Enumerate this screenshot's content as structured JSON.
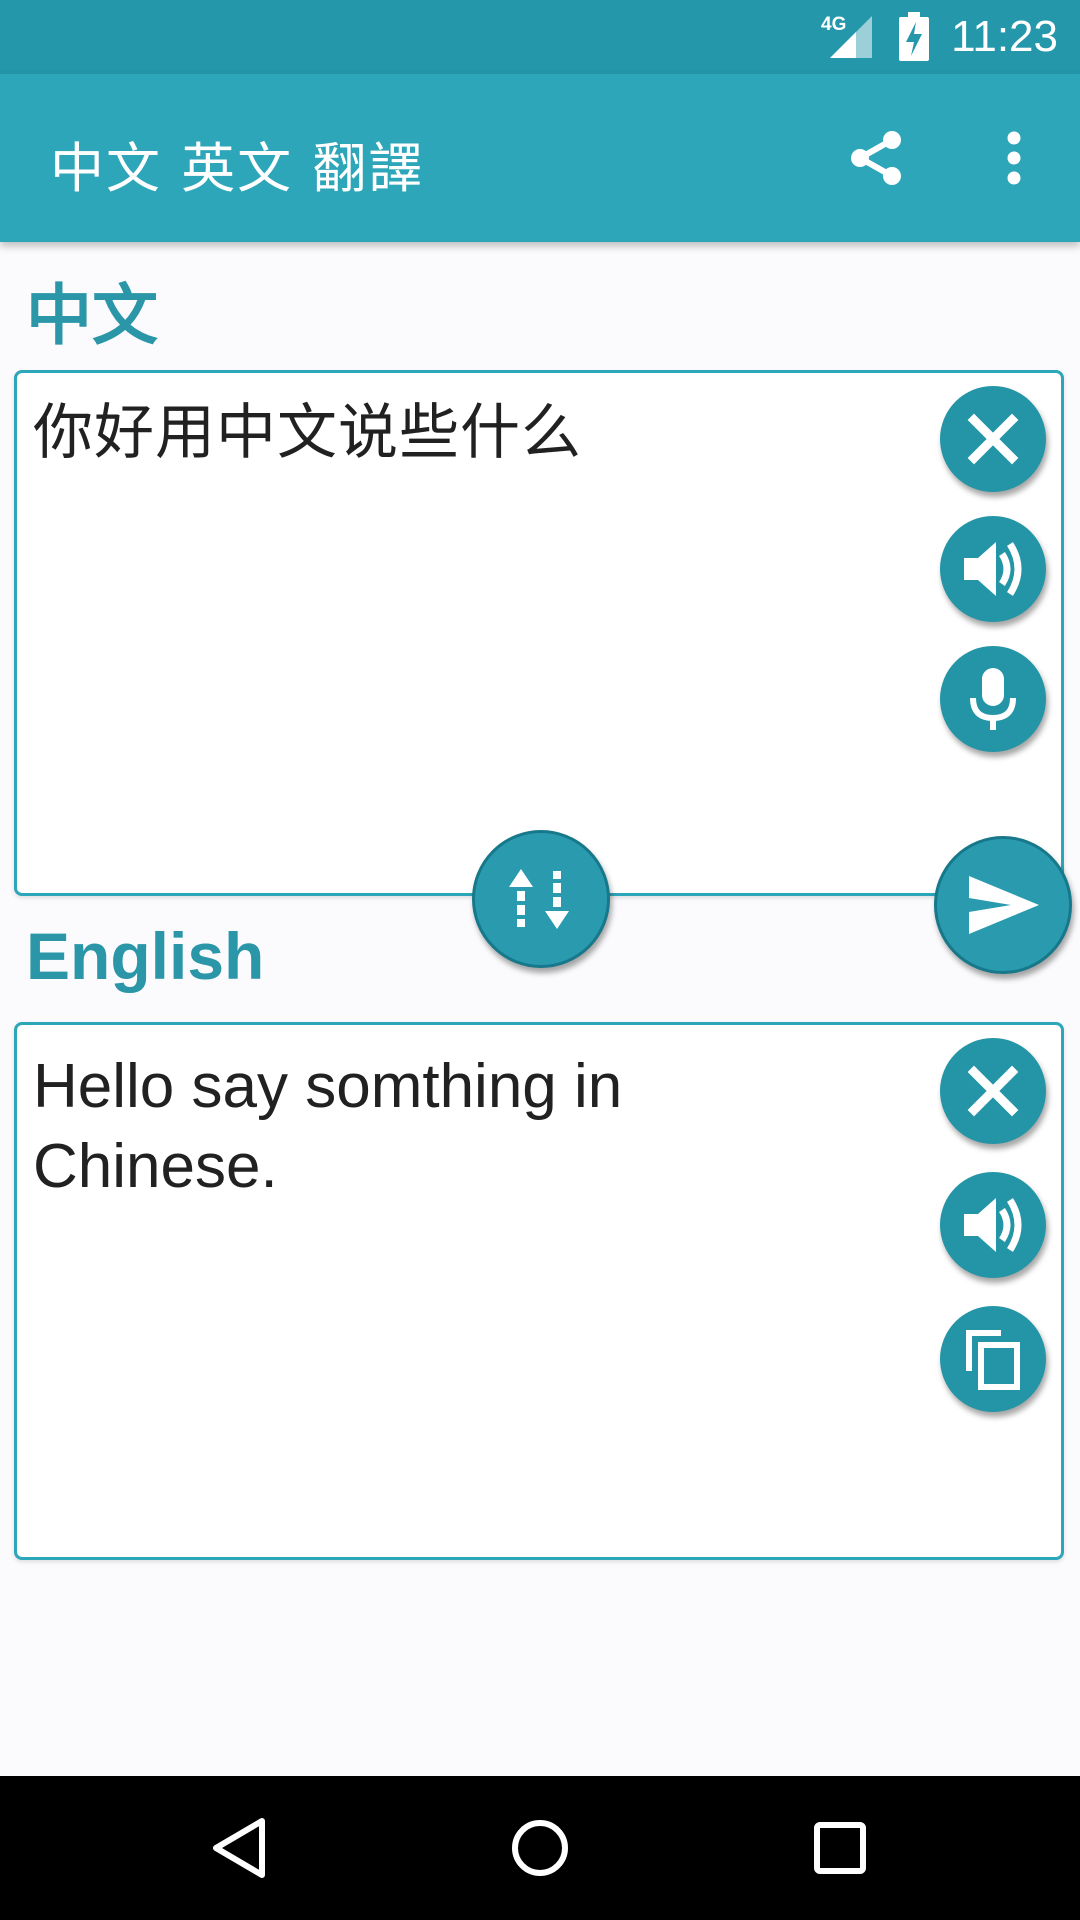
{
  "status_bar": {
    "network": "4G",
    "time": "11:23"
  },
  "app_bar": {
    "title": "中文 英文 翻譯",
    "icons": [
      "share-icon",
      "more-vert-icon"
    ]
  },
  "source": {
    "label": "中文",
    "text": "你好用中文说些什么",
    "buttons": [
      "clear-icon",
      "speaker-icon",
      "microphone-icon"
    ]
  },
  "target": {
    "label": "English",
    "text": "Hello say somthing in\nChinese.",
    "buttons": [
      "clear-icon",
      "speaker-icon",
      "copy-icon"
    ]
  },
  "actions": [
    "swap-languages-icon",
    "send-icon"
  ],
  "nav_bar": [
    "back-icon",
    "home-icon",
    "recents-icon"
  ],
  "colors": {
    "primary": "#2ea6b9",
    "primary_dark": "#2497ab",
    "fab": "#2495a6",
    "label": "#2a96a8"
  }
}
